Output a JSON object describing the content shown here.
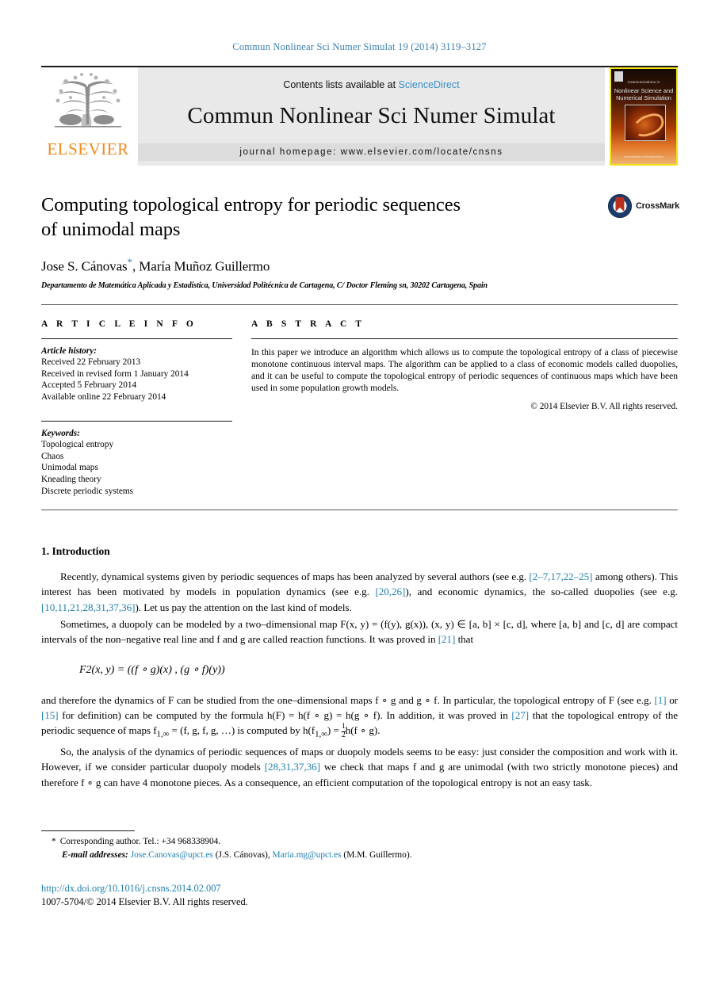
{
  "running_head": "Commun Nonlinear Sci Numer Simulat 19 (2014) 3119–3127",
  "masthead": {
    "publisher": "ELSEVIER",
    "contents_prefix": "Contents lists available at ",
    "contents_link": "ScienceDirect",
    "journal_title": "Commun Nonlinear Sci Numer Simulat",
    "homepage": "journal homepage: www.elsevier.com/locate/cnsns",
    "cover": {
      "line1": "Communications in",
      "line2": "Nonlinear Science and",
      "line3": "Numerical Simulation",
      "url": "www.elsevier.com/locate/cnsns"
    }
  },
  "article": {
    "title_line1": "Computing topological entropy for periodic sequences",
    "title_line2": "of unimodal maps",
    "authors": "Jose S. Cánovas",
    "corresponding_marker": "*",
    "authors_rest": ", María Muñoz Guillermo",
    "affiliation": "Departamento de Matemática Aplicada y Estadística, Universidad Politécnica de Cartagena, C/ Doctor Fleming sn, 30202 Cartagena, Spain",
    "crossmark_label": "CrossMark"
  },
  "info": {
    "heading": "A R T I C L E    I N F O",
    "history_label": "Article history:",
    "history": [
      "Received 22 February 2013",
      "Received in revised form 1 January 2014",
      "Accepted 5 February 2014",
      "Available online 22 February 2014"
    ],
    "keywords_label": "Keywords:",
    "keywords": [
      "Topological entropy",
      "Chaos",
      "Unimodal maps",
      "Kneading theory",
      "Discrete periodic systems"
    ]
  },
  "abstract": {
    "heading": "A B S T R A C T",
    "text": "In this paper we introduce an algorithm which allows us to compute the topological entropy of a class of piecewise monotone continuous interval maps. The algorithm can be applied to a class of economic models called duopolies, and it can be useful to compute the topological entropy of periodic sequences of continuous maps which have been used in some population growth models.",
    "copyright": "© 2014 Elsevier B.V. All rights reserved."
  },
  "introduction": {
    "heading": "1. Introduction",
    "p1_a": "Recently, dynamical systems given by periodic sequences of maps has been analyzed by several authors (see e.g. ",
    "p1_ref1": "[2–7,17,22–25]",
    "p1_b": " among others). This interest has been motivated by models in population dynamics (see e.g. ",
    "p1_ref2": "[20,26]",
    "p1_c": "), and economic dynamics, the so-called duopolies (see e.g. ",
    "p1_ref3": "[10,11,21,28,31,37,36]",
    "p1_d": "). Let us pay the attention on the last kind of models.",
    "p2_a": "Sometimes, a duopoly can be modeled by a two–dimensional map F(x, y) = (f(y), g(x)), (x, y) ∈ [a, b] × [c, d], where [a, b] and [c, d] are compact intervals of the non–negative real line and f and g are called reaction functions. It was proved in ",
    "p2_ref": "[21]",
    "p2_b": " that",
    "equation": "F2(x, y) = ((f ∘ g)(x) , (g ∘ f)(y))",
    "p3_a": "and therefore the dynamics of F can be studied from the one–dimensional maps f ∘ g and g ∘ f. In particular, the topological entropy of F (see e.g. ",
    "p3_ref1": "[1]",
    "p3_b": " or ",
    "p3_ref2": "[15]",
    "p3_c": " for definition) can be computed by the formula h(F) = h(f ∘ g) = h(g ∘ f). In addition, it was proved in ",
    "p3_ref3": "[27]",
    "p3_d": " that the topological entropy of the periodic sequence of maps f",
    "p3_sub": "1,∞",
    "p3_e": " = (f, g, f, g, …) is computed by",
    "p3_f_pre": "h(f",
    "p3_f_sub": "1,∞",
    "p3_f_post": ") = ",
    "p3_frac_num": "1",
    "p3_frac_den": "2",
    "p3_f_tail": "h(f ∘ g).",
    "p4_a": "So, the analysis of the dynamics of periodic sequences of maps or duopoly models seems to be easy: just consider the composition and work with it. However, if we consider particular duopoly models ",
    "p4_ref": "[28,31,37,36]",
    "p4_b": " we check that maps f and g are unimodal (with two strictly monotone pieces) and therefore f ∘ g can have 4 monotone pieces. As a consequence, an efficient computation of the topological entropy is not an easy task."
  },
  "footnotes": {
    "corresponding": "Corresponding author. Tel.: +34 968338904.",
    "asterisk": "*",
    "email_label": "E-mail addresses:",
    "email1": "Jose.Canovas@upct.es",
    "email1_owner": " (J.S. Cánovas), ",
    "email2": "Maria.mg@upct.es",
    "email2_owner": " (M.M. Guillermo).",
    "doi": "http://dx.doi.org/10.1016/j.cnsns.2014.02.007",
    "issn": "1007-5704/© 2014 Elsevier B.V. All rights reserved."
  },
  "colors": {
    "link": "#1f7fb0",
    "running_head": "#3a7fb1",
    "elsevier_orange": "#f08a1c",
    "sciencedirect": "#3a8fc9",
    "crossmark_blue": "#1c3c6e",
    "crossmark_red": "#b8311d"
  }
}
